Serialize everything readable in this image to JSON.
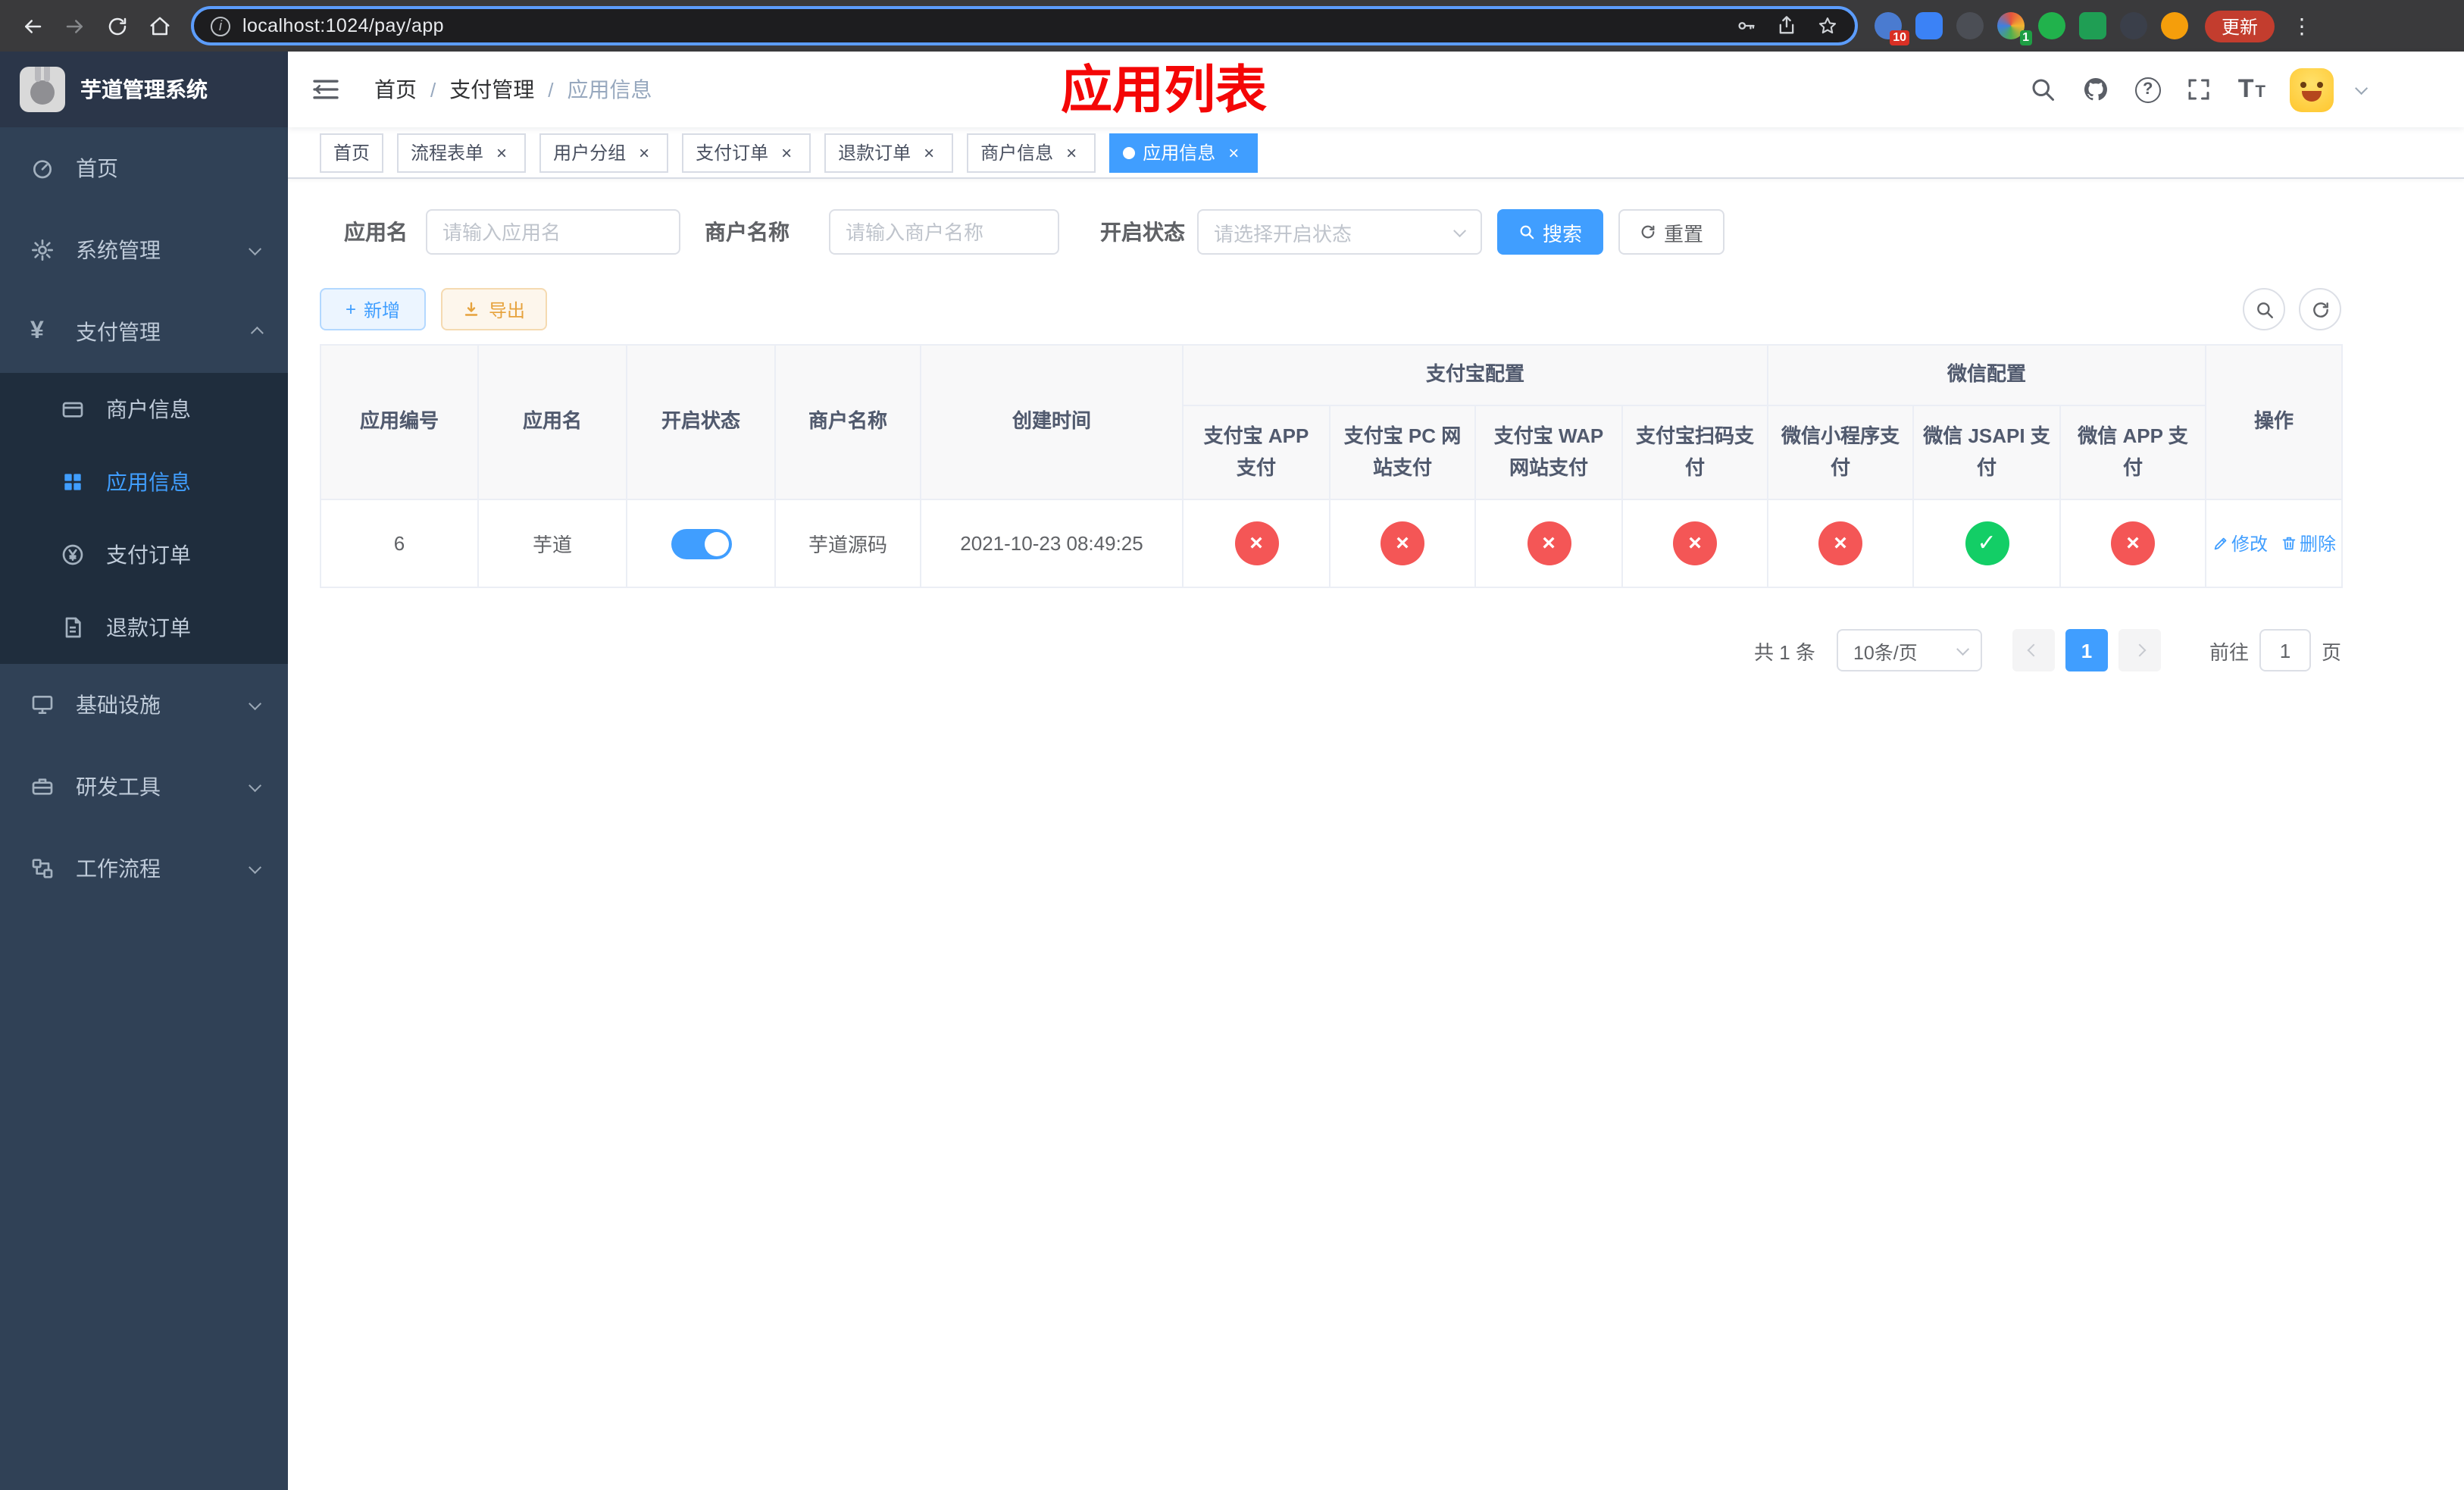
{
  "browser": {
    "url": "localhost:1024/pay/app",
    "update_label": "更新",
    "ext_badge_translate": "10",
    "ext_badge_tampermonkey": "1"
  },
  "glyphs": {
    "info": "i",
    "question": "?",
    "ellipsis": "⋮",
    "close": "×",
    "plus": "+",
    "yen": "¥",
    "check": "✓",
    "cross": "×",
    "font_big": "T",
    "font_small": "T"
  },
  "sidebar": {
    "title": "芋道管理系统",
    "menu": [
      {
        "label": "首页"
      },
      {
        "label": "系统管理"
      },
      {
        "label": "支付管理",
        "expanded": true,
        "children": [
          {
            "label": "商户信息"
          },
          {
            "label": "应用信息",
            "active": true
          },
          {
            "label": "支付订单"
          },
          {
            "label": "退款订单"
          }
        ]
      },
      {
        "label": "基础设施"
      },
      {
        "label": "研发工具"
      },
      {
        "label": "工作流程"
      }
    ]
  },
  "header": {
    "breadcrumb": [
      "首页",
      "支付管理",
      "应用信息"
    ],
    "separator": "/",
    "annotation": "应用列表"
  },
  "tabs": [
    {
      "label": "首页",
      "closable": false,
      "active": false
    },
    {
      "label": "流程表单",
      "closable": true,
      "active": false
    },
    {
      "label": "用户分组",
      "closable": true,
      "active": false
    },
    {
      "label": "支付订单",
      "closable": true,
      "active": false
    },
    {
      "label": "退款订单",
      "closable": true,
      "active": false
    },
    {
      "label": "商户信息",
      "closable": true,
      "active": false
    },
    {
      "label": "应用信息",
      "closable": true,
      "active": true
    }
  ],
  "filter": {
    "app_name_label": "应用名",
    "app_name_placeholder": "请输入应用名",
    "merchant_label": "商户名称",
    "merchant_placeholder": "请输入商户名称",
    "status_label": "开启状态",
    "status_placeholder": "请选择开启状态",
    "search_label": "搜索",
    "reset_label": "重置"
  },
  "toolbar": {
    "add_label": "新增",
    "export_label": "导出"
  },
  "table": {
    "headers": {
      "app_id": "应用编号",
      "app_name": "应用名",
      "status": "开启状态",
      "merchant": "商户名称",
      "created": "创建时间",
      "actions": "操作",
      "alipay_group": "支付宝配置",
      "wechat_group": "微信配置",
      "alipay_app": "支付宝 APP 支付",
      "alipay_pc": "支付宝 PC 网站支付",
      "alipay_wap": "支付宝 WAP 网站支付",
      "alipay_qr": "支付宝扫码支付",
      "wechat_mini": "微信小程序支付",
      "wechat_jsapi": "微信 JSAPI 支付",
      "wechat_app": "微信 APP 支付"
    },
    "rows": [
      {
        "app_id": "6",
        "app_name": "芋道",
        "status_on": true,
        "merchant": "芋道源码",
        "created": "2021-10-23 08:49:25",
        "channels": {
          "alipay_app": "disabled",
          "alipay_pc": "disabled",
          "alipay_wap": "disabled",
          "alipay_qr": "disabled",
          "wechat_mini": "disabled",
          "wechat_jsapi": "enabled",
          "wechat_app": "disabled"
        },
        "edit_label": "修改",
        "delete_label": "删除"
      }
    ]
  },
  "pagination": {
    "total": "共 1 条",
    "page_size": "10条/页",
    "current": "1",
    "goto_prefix": "前往",
    "goto_value": "1",
    "goto_suffix": "页"
  },
  "colors": {
    "primary": "#409eff",
    "danger": "#f45656",
    "success": "#13ce66",
    "annotation": "#f40606",
    "sidebar_bg": "#304156",
    "submenu_bg": "#1f2d3d",
    "table_header_bg": "#f8f8f9"
  }
}
